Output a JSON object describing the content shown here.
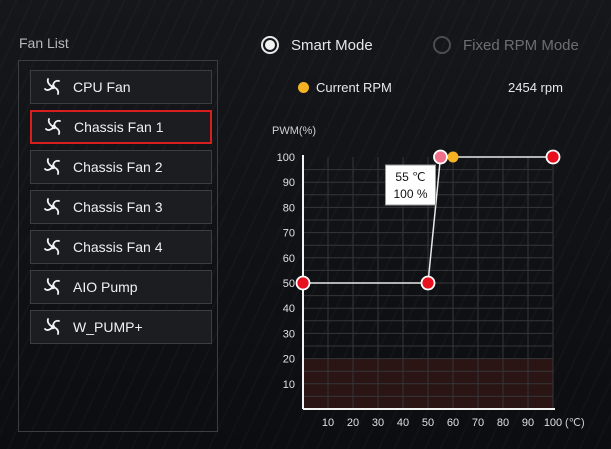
{
  "fan_list": {
    "title": "Fan List",
    "items": [
      {
        "label": "CPU Fan",
        "selected": false
      },
      {
        "label": "Chassis Fan 1",
        "selected": true
      },
      {
        "label": "Chassis Fan 2",
        "selected": false
      },
      {
        "label": "Chassis Fan 3",
        "selected": false
      },
      {
        "label": "Chassis Fan 4",
        "selected": false
      },
      {
        "label": "AIO Pump",
        "selected": false
      },
      {
        "label": "W_PUMP+",
        "selected": false
      }
    ]
  },
  "modes": {
    "smart_label": "Smart Mode",
    "fixed_label": "Fixed RPM Mode",
    "selected": "smart"
  },
  "rpm": {
    "label": "Current RPM",
    "value": "2454 rpm",
    "indicator_color": "#f5b324"
  },
  "colors": {
    "accent_red": "#d81e1e",
    "point_fill": "#e8101e",
    "selected_point_fill": "#f0708a",
    "danger_zone": "#2a1414"
  },
  "chart_data": {
    "type": "line",
    "ylabel": "PWM(%)",
    "xlabel": "(℃)",
    "xlim": [
      0,
      100
    ],
    "ylim": [
      0,
      100
    ],
    "x_ticks": [
      10,
      20,
      30,
      40,
      50,
      60,
      70,
      80,
      90,
      100
    ],
    "y_ticks": [
      10,
      20,
      30,
      40,
      50,
      60,
      70,
      80,
      90,
      100
    ],
    "grid": true,
    "low_limit_zone": {
      "y_max": 20
    },
    "series": [
      {
        "points": [
          [
            0,
            50
          ],
          [
            50,
            50
          ],
          [
            55,
            100
          ],
          [
            100,
            100
          ]
        ]
      }
    ],
    "selected_point_index": 2,
    "current_marker": {
      "x": 60,
      "y": 100
    },
    "tooltip": {
      "temp": "55 ℃",
      "pwm": "100 %"
    }
  }
}
